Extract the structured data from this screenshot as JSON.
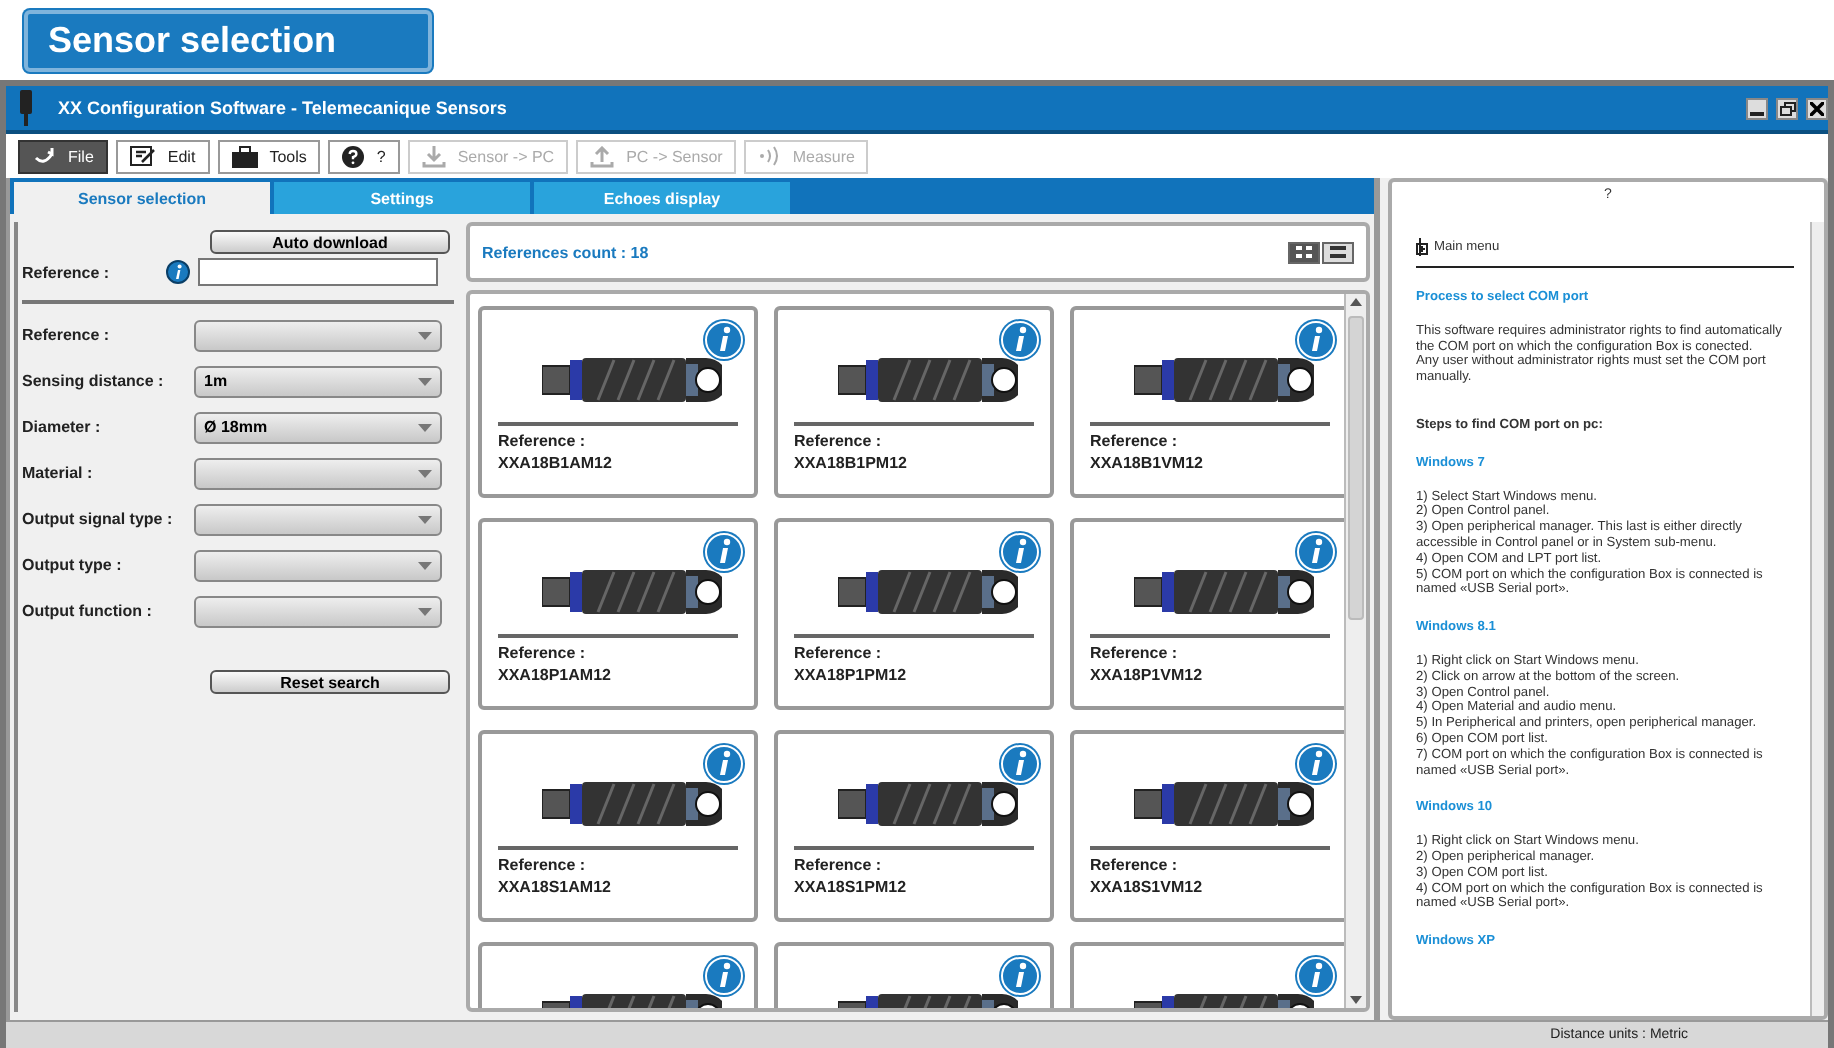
{
  "banner": {
    "title": "Sensor selection"
  },
  "window": {
    "title": "XX Configuration Software - Telemecanique Sensors"
  },
  "toolbar": [
    {
      "label": "File",
      "active": true,
      "disabled": false
    },
    {
      "label": "Edit",
      "active": false,
      "disabled": false
    },
    {
      "label": "Tools",
      "active": false,
      "disabled": false
    },
    {
      "label": "?",
      "active": false,
      "disabled": false
    },
    {
      "label": "Sensor -> PC",
      "active": false,
      "disabled": true
    },
    {
      "label": "PC -> Sensor",
      "active": false,
      "disabled": true
    },
    {
      "label": "Measure",
      "active": false,
      "disabled": true
    }
  ],
  "tabs": [
    {
      "label": "Sensor selection",
      "selected": true
    },
    {
      "label": "Settings",
      "selected": false
    },
    {
      "label": "Echoes display",
      "selected": false
    }
  ],
  "filters": {
    "auto_download": "Auto download",
    "reference_label": "Reference :",
    "fields": [
      {
        "label": "Reference :"
      },
      {
        "label": "Sensing distance :",
        "value": "1m"
      },
      {
        "label": "Diameter :",
        "value": "Ø 18mm"
      },
      {
        "label": "Material :"
      },
      {
        "label": "Output signal type :"
      },
      {
        "label": "Output type :"
      },
      {
        "label": "Output function :"
      }
    ],
    "reset": "Reset search"
  },
  "results": {
    "count": "References count : 18",
    "views": [
      {
        "kind": "grid",
        "selected": true
      },
      {
        "kind": "list",
        "selected": false
      }
    ],
    "cards": [
      {
        "kind": "full",
        "label": "Reference :",
        "reference": "XXA18B1AM12"
      },
      {
        "kind": "full",
        "label": "Reference :",
        "reference": "XXA18B1PM12"
      },
      {
        "kind": "full",
        "label": "Reference :",
        "reference": "XXA18B1VM12"
      },
      {
        "kind": "full",
        "label": "Reference :",
        "reference": "XXA18P1AM12"
      },
      {
        "kind": "full",
        "label": "Reference :",
        "reference": "XXA18P1PM12"
      },
      {
        "kind": "full",
        "label": "Reference :",
        "reference": "XXA18P1VM12"
      },
      {
        "kind": "full",
        "label": "Reference :",
        "reference": "XXA18S1AM12"
      },
      {
        "kind": "full",
        "label": "Reference :",
        "reference": "XXA18S1PM12"
      },
      {
        "kind": "full",
        "label": "Reference :",
        "reference": "XXA18S1VM12"
      },
      {
        "kind": "clipped"
      },
      {
        "kind": "clipped"
      },
      {
        "kind": "clipped"
      }
    ]
  },
  "help": {
    "title": "?",
    "main_menu": "Main menu",
    "blocks": [
      {
        "kind": "heading",
        "text": "Process to select COM port"
      },
      {
        "kind": "paragraph",
        "lines": [
          "This software requires administrator rights to find automatically",
          "the COM port on which the configuration Box is conected.",
          "Any user without administrator rights must set the COM port",
          "manually."
        ]
      },
      {
        "kind": "subheading",
        "text": "Steps to find COM port on pc:"
      },
      {
        "kind": "heading",
        "text": "Windows 7"
      },
      {
        "kind": "paragraph",
        "lines": [
          "1) Select Start Windows menu.",
          "2) Open Control panel.",
          "3) Open peripherical manager. This last is either directly",
          "accessible in Control panel or in System sub-menu.",
          "4) Open COM and LPT port list.",
          "5) COM port on which the configuration Box is connected is",
          "named «USB Serial port»."
        ]
      },
      {
        "kind": "heading",
        "text": "Windows 8.1"
      },
      {
        "kind": "paragraph",
        "lines": [
          "1) Right click on Start Windows menu.",
          "2) Click on arrow at the bottom of the screen.",
          "3) Open Control panel.",
          "4) Open Material and audio menu.",
          "5) In Peripherical and printers, open peripherical manager.",
          "6) Open COM port list.",
          "7) COM port on which the configuration Box is connected is",
          "named «USB Serial port»."
        ]
      },
      {
        "kind": "heading",
        "text": "Windows 10"
      },
      {
        "kind": "paragraph",
        "lines": [
          "1) Right click on Start Windows menu.",
          "2) Open peripherical manager.",
          "3) Open COM port list.",
          "4) COM port on which the configuration Box is connected is",
          "named «USB Serial port»."
        ]
      },
      {
        "kind": "heading",
        "text": "Windows XP"
      }
    ]
  },
  "status_bar": {
    "text": "Distance units : Metric"
  }
}
